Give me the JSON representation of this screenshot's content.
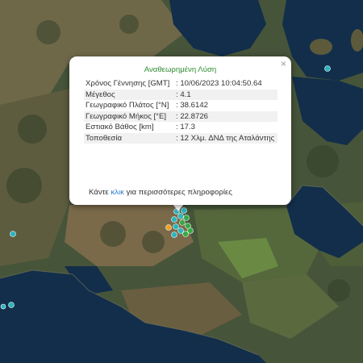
{
  "popup": {
    "title": "Αναθεωρημένη Λύση",
    "close_symbol": "×",
    "rows": [
      {
        "label": "Χρόνος Γέννησης [GMT]",
        "value": ": 10/06/2023 10:04:50.64"
      },
      {
        "label": "Μέγεθος",
        "value": ": 4.1"
      },
      {
        "label": "Γεωγραφικό Πλάτος [°N]",
        "value": ": 38.6142"
      },
      {
        "label": "Γεωγραφικό Μήκος [°E]",
        "value": ": 22.8726"
      },
      {
        "label": "Εστιακό Βάθος [km]",
        "value": ": 17.3"
      },
      {
        "label": "Τοποθεσία",
        "value": ": 12 Χλμ. ΔΝΔ της Αταλάντης"
      }
    ],
    "footer_prefix": "Κάντε",
    "footer_link": "κλικ",
    "footer_suffix": "για περισσότερες πληροφορίες"
  },
  "markers": {
    "colors": {
      "cyan": "#2ab5c0",
      "green": "#33aa44",
      "orange": "#f0a020",
      "white": "#ffffff"
    },
    "icon": "earthquake-marker-icon"
  },
  "map": {
    "colors": {
      "sea": "#0f2a45",
      "land_dark": "#3a4a2e",
      "land_brown": "#7a6a48",
      "farmland": "#5a7a3a"
    }
  }
}
